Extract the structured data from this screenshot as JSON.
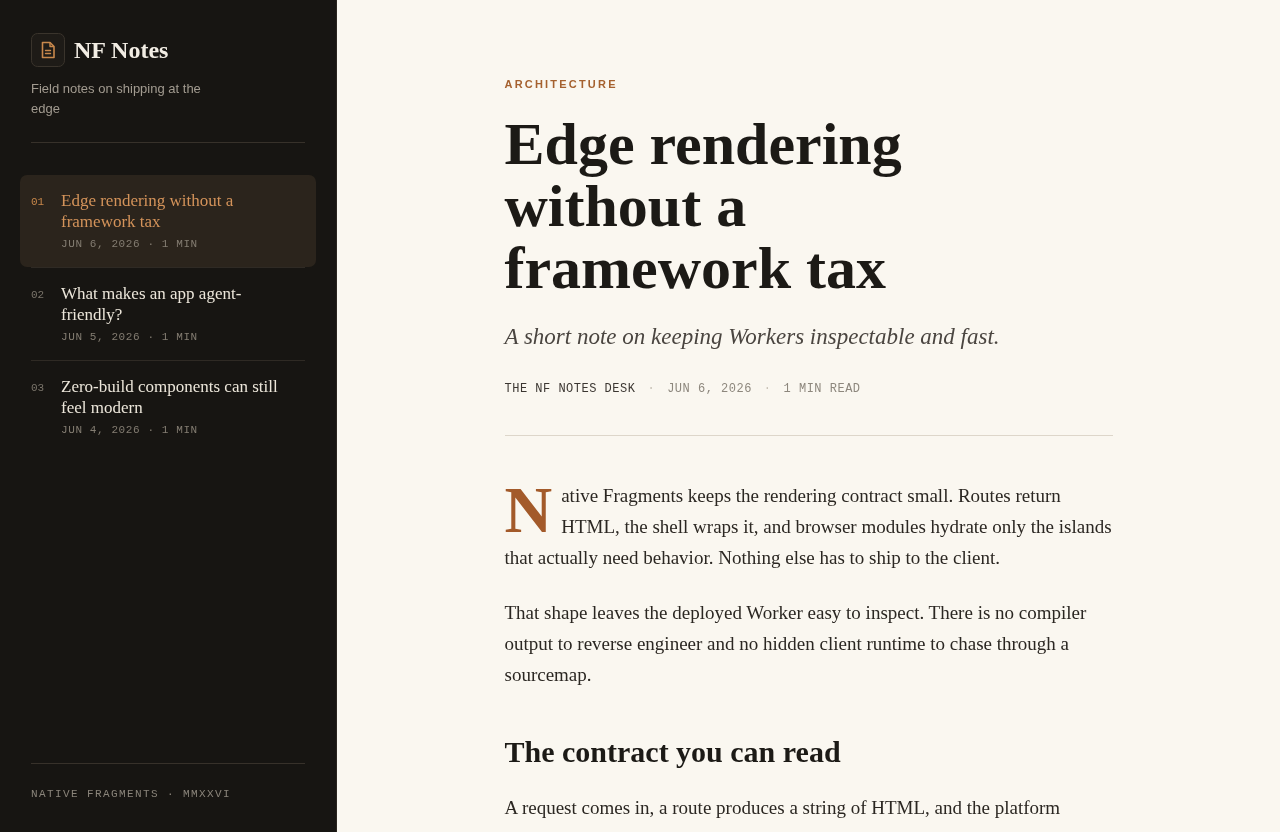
{
  "sidebar": {
    "brand": {
      "title": "NF Notes",
      "tagline": "Field notes on shipping at the edge"
    },
    "posts": [
      {
        "number": "01",
        "title": "Edge rendering without a framework tax",
        "meta": "JUN 6, 2026 · 1 MIN",
        "selected": true
      },
      {
        "number": "02",
        "title": "What makes an app agent-friendly?",
        "meta": "JUN 5, 2026 · 1 MIN",
        "selected": false
      },
      {
        "number": "03",
        "title": "Zero-build components can still feel modern",
        "meta": "JUN 4, 2026 · 1 MIN",
        "selected": false
      }
    ],
    "footer": "NATIVE FRAGMENTS · MMXXVI"
  },
  "article": {
    "category": "ARCHITECTURE",
    "title": "Edge rendering without a framework tax",
    "subtitle": "A short note on keeping Workers inspectable and fast.",
    "byline": [
      {
        "kind": "author",
        "text": "THE NF NOTES DESK"
      },
      {
        "kind": "separator",
        "text": "·"
      },
      {
        "kind": "date",
        "text": "JUN 6, 2026"
      },
      {
        "kind": "separator",
        "text": "·"
      },
      {
        "kind": "reading_time",
        "text": "1 MIN READ"
      }
    ],
    "body": [
      {
        "kind": "lead",
        "text": "Native Fragments keeps the rendering contract small. Routes return HTML, the shell wraps it, and browser modules hydrate only the islands that actually need behavior. Nothing else has to ship to the client."
      },
      {
        "kind": "paragraph",
        "text": "That shape leaves the deployed Worker easy to inspect. There is no compiler output to reverse engineer and no hidden client runtime to chase through a sourcemap."
      },
      {
        "kind": "heading",
        "text": "The contract you can read"
      },
      {
        "kind": "paragraph",
        "text": "A request comes in, a route produces a string of HTML, and the platform"
      }
    ]
  }
}
